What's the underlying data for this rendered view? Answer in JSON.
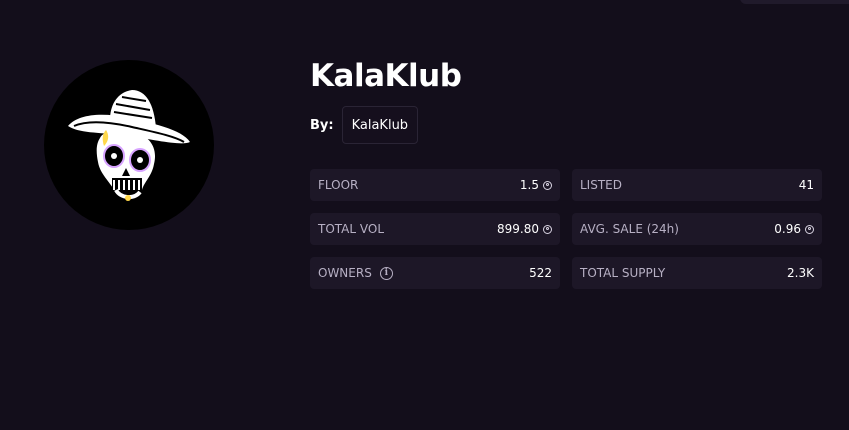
{
  "collection": {
    "title": "KalaKlub",
    "by_label": "By:",
    "creator": "KalaKlub"
  },
  "stats": {
    "floor": {
      "label": "FLOOR",
      "value": "1.5",
      "icon": "sol-icon"
    },
    "listed": {
      "label": "LISTED",
      "value": "41"
    },
    "total_vol": {
      "label": "TOTAL VOL",
      "value": "899.80",
      "icon": "sol-icon"
    },
    "avg_sale": {
      "label": "AVG. SALE (24h)",
      "value": "0.96",
      "icon": "sol-icon"
    },
    "owners": {
      "label": "OWNERS",
      "value": "522",
      "icon": "info-icon",
      "icon_glyph": "i"
    },
    "total_supply": {
      "label": "TOTAL SUPPLY",
      "value": "2.3K"
    }
  },
  "colors": {
    "background": "#130e1b",
    "card": "#1d1727",
    "label": "#b7b0c4",
    "text": "#ffffff"
  }
}
